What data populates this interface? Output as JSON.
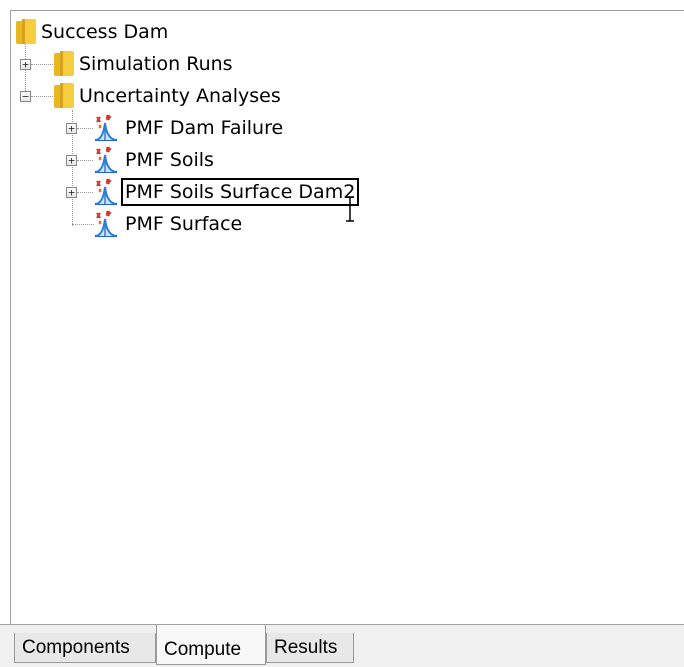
{
  "tree": {
    "root": {
      "label": "Success Dam",
      "icon": "folder-icon"
    },
    "children": [
      {
        "label": "Simulation Runs",
        "icon": "folder-icon",
        "expanded": false
      },
      {
        "label": "Uncertainty Analyses",
        "icon": "folder-icon",
        "expanded": true,
        "children": [
          {
            "label": "PMF Dam Failure",
            "icon": "uncertainty-analysis-icon",
            "expanded": false
          },
          {
            "label": "PMF Soils",
            "icon": "uncertainty-analysis-icon",
            "expanded": false
          },
          {
            "label": "PMF Soils Surface Dam2",
            "icon": "uncertainty-analysis-icon",
            "expanded": false,
            "editing": true
          },
          {
            "label": "PMF Surface",
            "icon": "uncertainty-analysis-icon"
          }
        ]
      }
    ]
  },
  "tabs": [
    {
      "label": "Components",
      "active": false
    },
    {
      "label": "Compute",
      "active": true
    },
    {
      "label": "Results",
      "active": false
    }
  ],
  "colors": {
    "folder": "#e8b820",
    "folder_dark": "#c8901a",
    "analysis_blue": "#2a7de1",
    "analysis_red": "#e03020"
  }
}
